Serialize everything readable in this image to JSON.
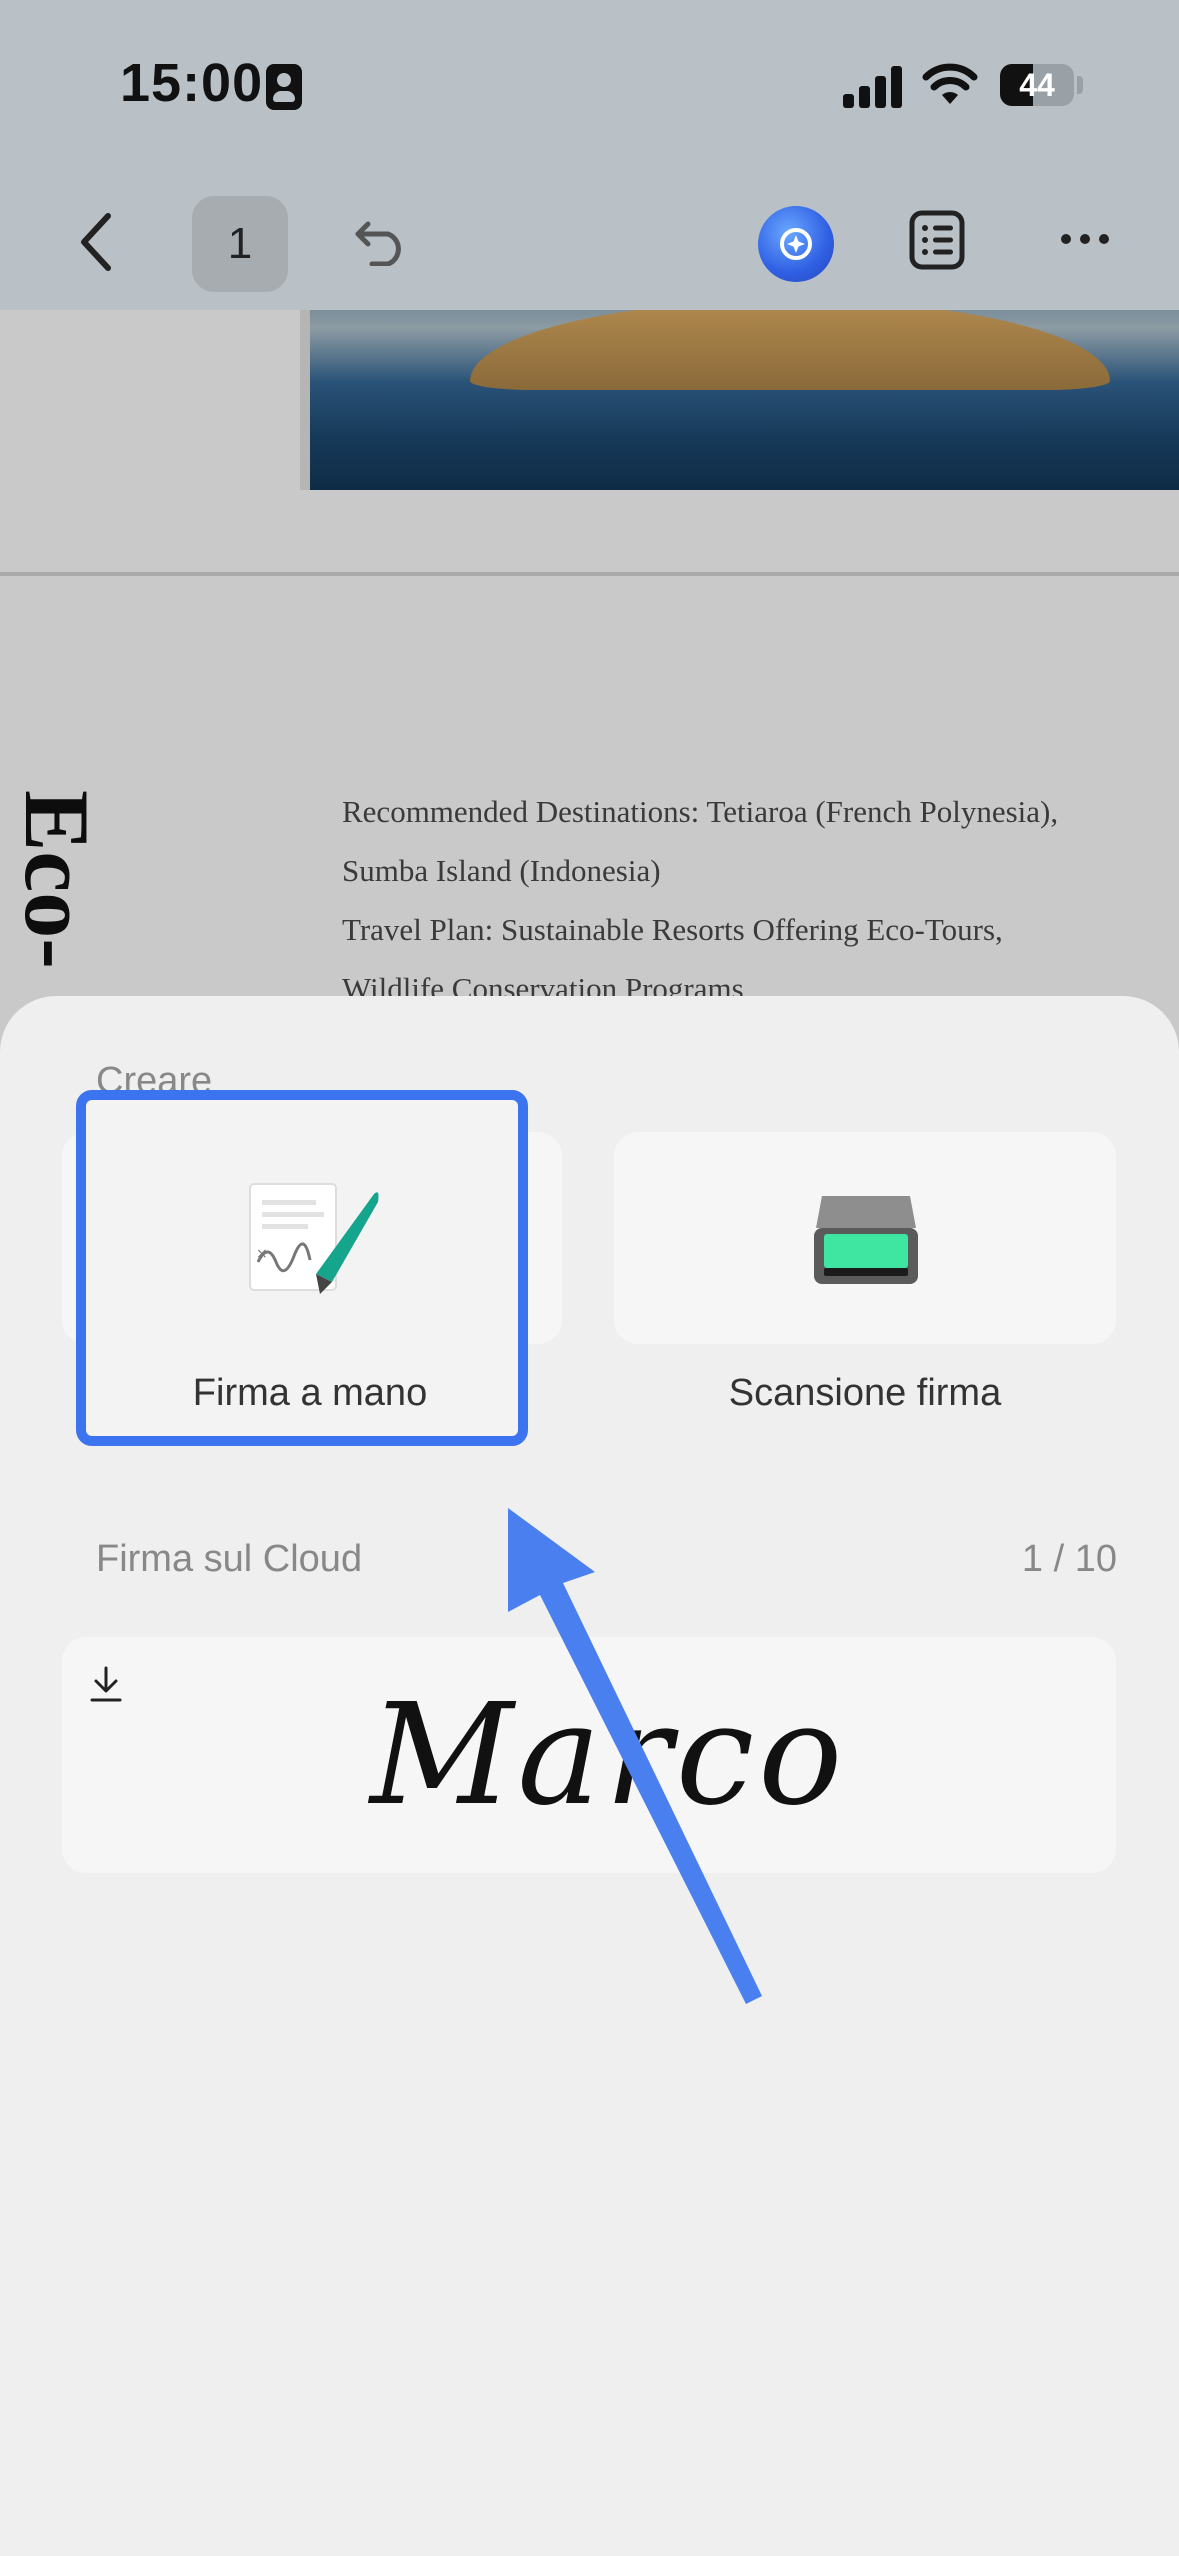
{
  "status_bar": {
    "time": "15:00",
    "battery": "44"
  },
  "nav": {
    "page_number": "1"
  },
  "document": {
    "vertical_title": "Eco-",
    "lines": [
      "Recommended Destinations: Tetiaroa (French Polynesia),",
      "Sumba Island (Indonesia)",
      "Travel Plan: Sustainable Resorts Offering Eco-Tours,",
      "Wildlife Conservation Programs"
    ]
  },
  "sheet": {
    "create_label": "Creare",
    "options": [
      {
        "label": "Firma a mano",
        "icon": "handwritten-signature-icon"
      },
      {
        "label": "Scansione firma",
        "icon": "scanner-icon"
      }
    ],
    "cloud_label": "Firma sul Cloud",
    "cloud_count": "1 / 10",
    "saved_signature": "Marco"
  },
  "colors": {
    "highlight": "#3b74ee",
    "arrow": "#4a7ff0"
  }
}
